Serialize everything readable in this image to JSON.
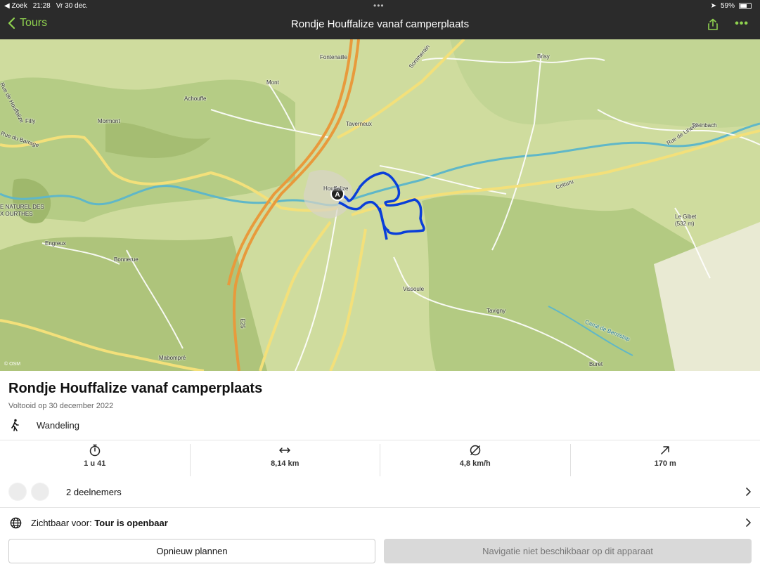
{
  "status_bar": {
    "back_app": "◀ Zoek",
    "time": "21:28",
    "date": "Vr 30 dec.",
    "battery": "59%",
    "multitask": "•••"
  },
  "nav": {
    "back_label": "Tours",
    "title": "Rondje Houffalize vanaf camperplaats",
    "more": "•••"
  },
  "map": {
    "labels": {
      "fontenaille": "Fontenaille",
      "brisy": "Brisy",
      "mont": "Mont",
      "achouffe": "Achouffe",
      "filly": "Filly",
      "mormont": "Mormont",
      "taverneux": "Taverneux",
      "steinbach": "Steinbach",
      "rue_houffalize": "Rue de Houffalize",
      "rue_barrage": "Rue du Barrage",
      "rue_liherin": "Rue de Liherin",
      "sommerain": "Sommerain",
      "cetturu": "Cetturu",
      "parc1": "E NATUREL DES",
      "parc2": "X OURTHES",
      "engreux": "Engreux",
      "bonnerue": "Bonnerue",
      "houffalize": "Houffalize",
      "le_gibet": "Le Gibet",
      "le_gibet_alt": "(532 m)",
      "vissoule": "Vissoule",
      "tavigny": "Tavigny",
      "mabompre": "Mabompré",
      "buret": "Buret",
      "canal": "Canal de Bernistap",
      "e25": "E25",
      "start_marker": "A"
    },
    "attribution": "© OSM",
    "route_color": "#0a3fd9"
  },
  "tour": {
    "title": "Rondje Houffalize vanaf camperplaats",
    "completed": "Voltooid op 30 december 2022",
    "sport": "Wandeling"
  },
  "stats": {
    "duration": "1 u 41",
    "distance": "8,14 km",
    "speed": "4,8 km/h",
    "elevation": "170 m"
  },
  "participants": {
    "label": "2 deelnemers"
  },
  "visibility": {
    "prefix": "Zichtbaar voor: ",
    "value": "Tour is openbaar"
  },
  "buttons": {
    "replan": "Opnieuw plannen",
    "navigation": "Navigatie niet beschikbaar op dit apparaat"
  }
}
